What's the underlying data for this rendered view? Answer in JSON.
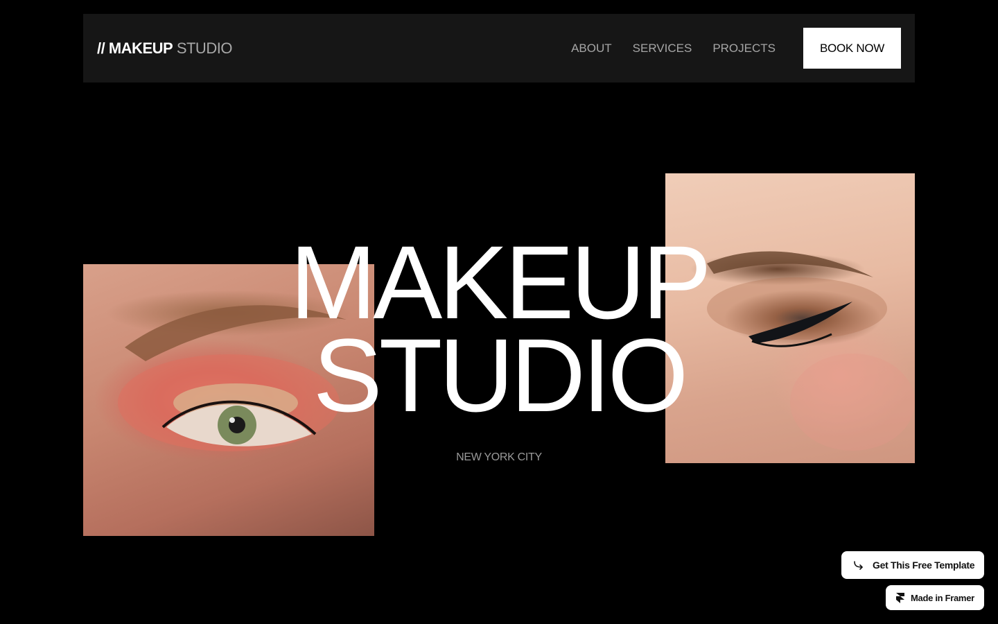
{
  "header": {
    "logo_prefix": "// MAKEUP",
    "logo_suffix": "STUDIO",
    "nav": [
      {
        "label": "ABOUT"
      },
      {
        "label": "SERVICES"
      },
      {
        "label": "PROJECTS"
      }
    ],
    "cta_label": "BOOK NOW"
  },
  "hero": {
    "title_line1": "MAKEUP",
    "title_line2": "STUDIO",
    "location": "NEW YORK CITY"
  },
  "badges": {
    "template_label": "Get This Free Template",
    "framer_label": "Made in Framer",
    "template_icon": "arrow-return-icon",
    "framer_icon": "framer-logo-icon"
  },
  "images": {
    "left": "eye-with-coral-shadow-photo",
    "right": "closed-eye-with-eyeliner-photo"
  },
  "colors": {
    "background": "#000000",
    "header_bg": "#161616",
    "nav_text": "#a6a6a6",
    "button_bg": "#ffffff",
    "button_text": "#000000",
    "subtitle": "#9a9a9a"
  }
}
